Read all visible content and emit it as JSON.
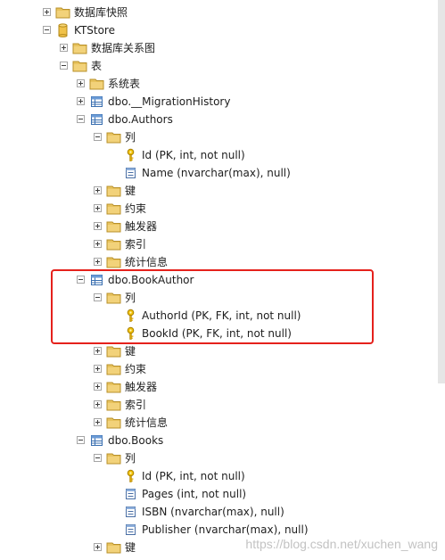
{
  "tree": {
    "rows": [
      {
        "level": 0,
        "expander": "plus",
        "icon": "folder-icon",
        "label": "数据库快照"
      },
      {
        "level": 0,
        "expander": "minus",
        "icon": "database-icon",
        "label": "KTStore"
      },
      {
        "level": 1,
        "expander": "plus",
        "icon": "folder-icon",
        "label": "数据库关系图"
      },
      {
        "level": 1,
        "expander": "minus",
        "icon": "folder-icon",
        "label": "表"
      },
      {
        "level": 2,
        "expander": "plus",
        "icon": "folder-icon",
        "label": "系统表"
      },
      {
        "level": 2,
        "expander": "plus",
        "icon": "table-icon",
        "label": "dbo.__MigrationHistory"
      },
      {
        "level": 2,
        "expander": "minus",
        "icon": "table-icon",
        "label": "dbo.Authors"
      },
      {
        "level": 3,
        "expander": "minus",
        "icon": "folder-icon",
        "label": "列"
      },
      {
        "level": 4,
        "expander": "none",
        "icon": "key-icon",
        "label": "Id (PK, int, not null)"
      },
      {
        "level": 4,
        "expander": "none",
        "icon": "column-icon",
        "label": "Name (nvarchar(max), null)"
      },
      {
        "level": 3,
        "expander": "plus",
        "icon": "folder-icon",
        "label": "键"
      },
      {
        "level": 3,
        "expander": "plus",
        "icon": "folder-icon",
        "label": "约束"
      },
      {
        "level": 3,
        "expander": "plus",
        "icon": "folder-icon",
        "label": "触发器"
      },
      {
        "level": 3,
        "expander": "plus",
        "icon": "folder-icon",
        "label": "索引"
      },
      {
        "level": 3,
        "expander": "plus",
        "icon": "folder-icon",
        "label": "统计信息"
      },
      {
        "level": 2,
        "expander": "minus",
        "icon": "table-icon",
        "label": "dbo.BookAuthor"
      },
      {
        "level": 3,
        "expander": "minus",
        "icon": "folder-icon",
        "label": "列"
      },
      {
        "level": 4,
        "expander": "none",
        "icon": "key-icon",
        "label": "AuthorId (PK, FK, int, not null)"
      },
      {
        "level": 4,
        "expander": "none",
        "icon": "key-icon",
        "label": "BookId (PK, FK, int, not null)"
      },
      {
        "level": 3,
        "expander": "plus",
        "icon": "folder-icon",
        "label": "键"
      },
      {
        "level": 3,
        "expander": "plus",
        "icon": "folder-icon",
        "label": "约束"
      },
      {
        "level": 3,
        "expander": "plus",
        "icon": "folder-icon",
        "label": "触发器"
      },
      {
        "level": 3,
        "expander": "plus",
        "icon": "folder-icon",
        "label": "索引"
      },
      {
        "level": 3,
        "expander": "plus",
        "icon": "folder-icon",
        "label": "统计信息"
      },
      {
        "level": 2,
        "expander": "minus",
        "icon": "table-icon",
        "label": "dbo.Books"
      },
      {
        "level": 3,
        "expander": "minus",
        "icon": "folder-icon",
        "label": "列"
      },
      {
        "level": 4,
        "expander": "none",
        "icon": "key-icon",
        "label": "Id (PK, int, not null)"
      },
      {
        "level": 4,
        "expander": "none",
        "icon": "column-icon",
        "label": "Pages (int, not null)"
      },
      {
        "level": 4,
        "expander": "none",
        "icon": "column-icon",
        "label": "ISBN (nvarchar(max), null)"
      },
      {
        "level": 4,
        "expander": "none",
        "icon": "column-icon",
        "label": "Publisher (nvarchar(max), null)"
      },
      {
        "level": 3,
        "expander": "plus",
        "icon": "folder-icon",
        "label": "键"
      }
    ]
  },
  "watermark": "https://blog.csdn.net/xuchen_wang",
  "colors": {
    "highlight": "#e5211c",
    "folder": "#dcb85a",
    "table": "#3a6fb0",
    "key": "#e0a800"
  }
}
